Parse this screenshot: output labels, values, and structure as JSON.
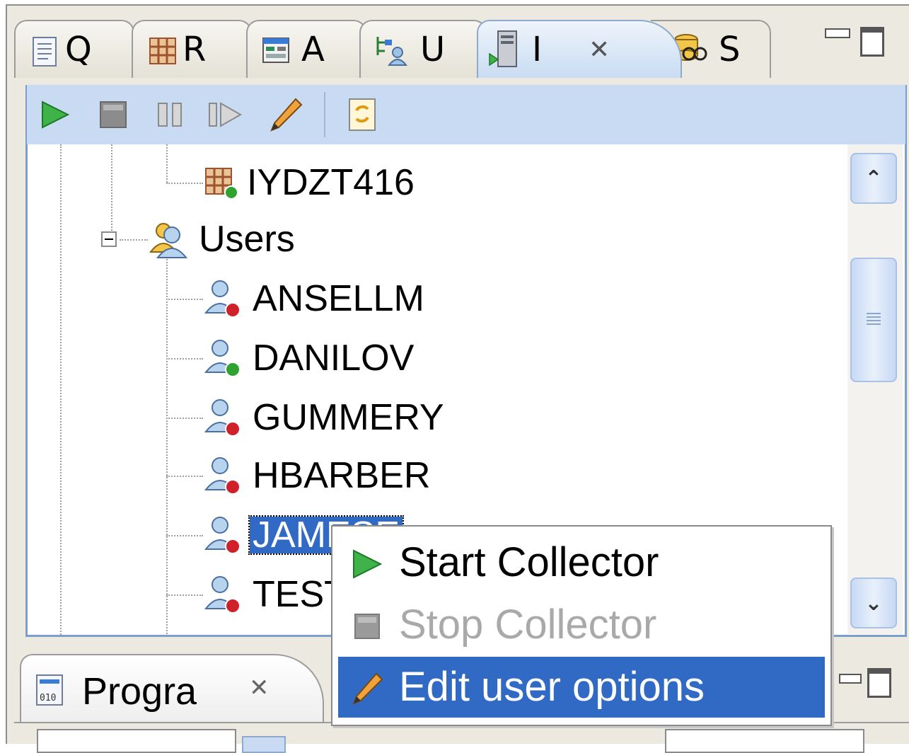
{
  "tabs": [
    {
      "label": "Q",
      "icon": "document-icon"
    },
    {
      "label": "R",
      "icon": "grid-icon"
    },
    {
      "label": "A",
      "icon": "window-icon"
    },
    {
      "label": "U",
      "icon": "tree-user-icon"
    },
    {
      "label": "I",
      "icon": "server-icon",
      "active": true
    },
    {
      "label": "S",
      "icon": "database-icon"
    }
  ],
  "toolbar": {
    "buttons": [
      "play-icon",
      "stop-icon",
      "pause-icon",
      "step-icon",
      "pencil-icon",
      "refresh-icon"
    ]
  },
  "tree": {
    "item_above": "IYDZT416",
    "group_label": "Users",
    "users": [
      {
        "name": "ANSELLM",
        "status": "stopped"
      },
      {
        "name": "DANILOV",
        "status": "running"
      },
      {
        "name": "GUMMERY",
        "status": "stopped"
      },
      {
        "name": "HBARBER",
        "status": "stopped"
      },
      {
        "name": "JAMESE",
        "status": "stopped",
        "selected": true
      },
      {
        "name": "TESTUSER",
        "status": "stopped"
      }
    ]
  },
  "context_menu": {
    "items": [
      {
        "label": "Start Collector",
        "icon": "play-icon",
        "enabled": true
      },
      {
        "label": "Stop Collector",
        "icon": "stop-icon",
        "enabled": false
      },
      {
        "label": "Edit user options",
        "icon": "pencil-icon",
        "enabled": true,
        "highlighted": true
      }
    ]
  },
  "bottom_panel": {
    "tab_label": "Progra"
  },
  "colors": {
    "selection": "#316ac5",
    "status_running": "#2fa32f",
    "status_stopped": "#d0202a",
    "toolbar_bg": "#c9dbf3"
  }
}
